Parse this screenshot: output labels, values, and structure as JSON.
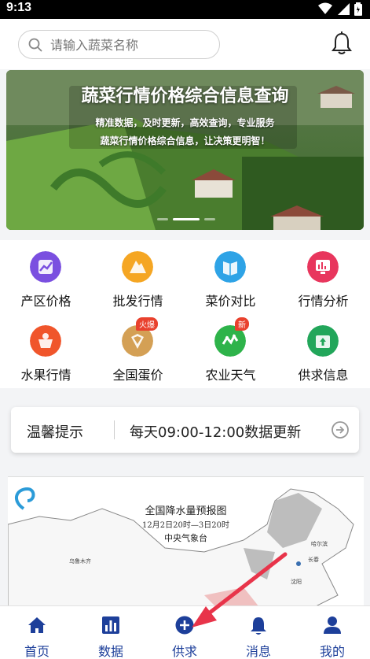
{
  "status_bar": {
    "time": "9:13"
  },
  "search": {
    "placeholder": "请输入蔬菜名称"
  },
  "banner": {
    "title": "蔬菜行情价格综合信息查询",
    "line1": "精准数据，及时更新，高效查询，专业服务",
    "line2": "蔬菜行情价格综合信息，让决策更明智！",
    "slides": 3,
    "active_slide": 2
  },
  "features": [
    {
      "label": "产区价格",
      "color": "#7a4fe0",
      "icon": "trend-chart-icon"
    },
    {
      "label": "批发行情",
      "color": "#f5a623",
      "icon": "mountain-icon"
    },
    {
      "label": "菜价对比",
      "color": "#2ea3e6",
      "icon": "book-icon"
    },
    {
      "label": "行情分析",
      "color": "#e8365d",
      "icon": "monitor-chart-icon"
    },
    {
      "label": "水果行情",
      "color": "#f0552b",
      "icon": "fruit-basket-icon",
      "badge": ""
    },
    {
      "label": "全国蛋价",
      "color": "#d4a055",
      "icon": "egg-tray-icon",
      "badge": "火爆"
    },
    {
      "label": "农业天气",
      "color": "#2eb34a",
      "icon": "weather-graph-icon",
      "badge": "新"
    },
    {
      "label": "供求信息",
      "color": "#22a65a",
      "icon": "supply-box-icon",
      "badge": ""
    }
  ],
  "tip": {
    "label": "温馨提示",
    "text": "每天09:00-12:00数据更新"
  },
  "map": {
    "title": "全国降水量预报图",
    "subtitle": "12月2日20时—3日20时",
    "author": "中央气象台",
    "cities": [
      "乌鲁木齐",
      "哈尔滨",
      "长春",
      "沈阳"
    ]
  },
  "tabs": [
    {
      "label": "首页",
      "icon": "home-icon"
    },
    {
      "label": "数据",
      "icon": "bar-chart-icon"
    },
    {
      "label": "供求",
      "icon": "plus-circle-icon"
    },
    {
      "label": "消息",
      "icon": "bell-icon"
    },
    {
      "label": "我的",
      "icon": "user-icon"
    }
  ],
  "colors": {
    "brand": "#1d3f9a",
    "annotation_arrow": "#e8344a"
  }
}
